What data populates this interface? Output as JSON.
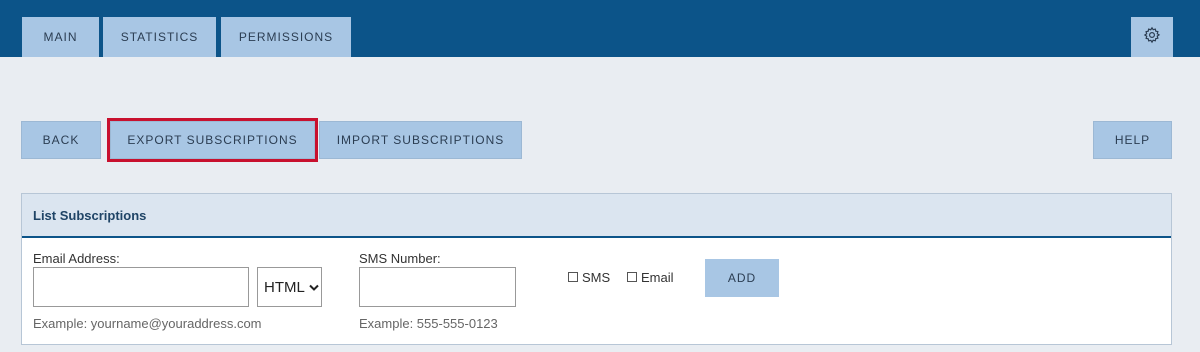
{
  "tabs": [
    {
      "label": "MAIN"
    },
    {
      "label": "STATISTICS"
    },
    {
      "label": "PERMISSIONS"
    }
  ],
  "settings": {
    "icon": "gear-icon"
  },
  "toolbar": {
    "back_label": "BACK",
    "export_label": "EXPORT SUBSCRIPTIONS",
    "import_label": "IMPORT SUBSCRIPTIONS",
    "help_label": "HELP"
  },
  "panel": {
    "title": "List Subscriptions",
    "email_label": "Email Address:",
    "email_value": "",
    "email_hint": "Example: yourname@youraddress.com",
    "format_selected": "HTML",
    "sms_label": "SMS Number:",
    "sms_value": "",
    "sms_hint": "Example: 555-555-0123",
    "sms_checkbox_label": "SMS",
    "email_checkbox_label": "Email",
    "add_label": "ADD"
  },
  "colors": {
    "topbar": "#0c5489",
    "tab_bg": "#a8c6e4",
    "highlight": "#c8102e",
    "page_bg": "#e9edf2"
  }
}
